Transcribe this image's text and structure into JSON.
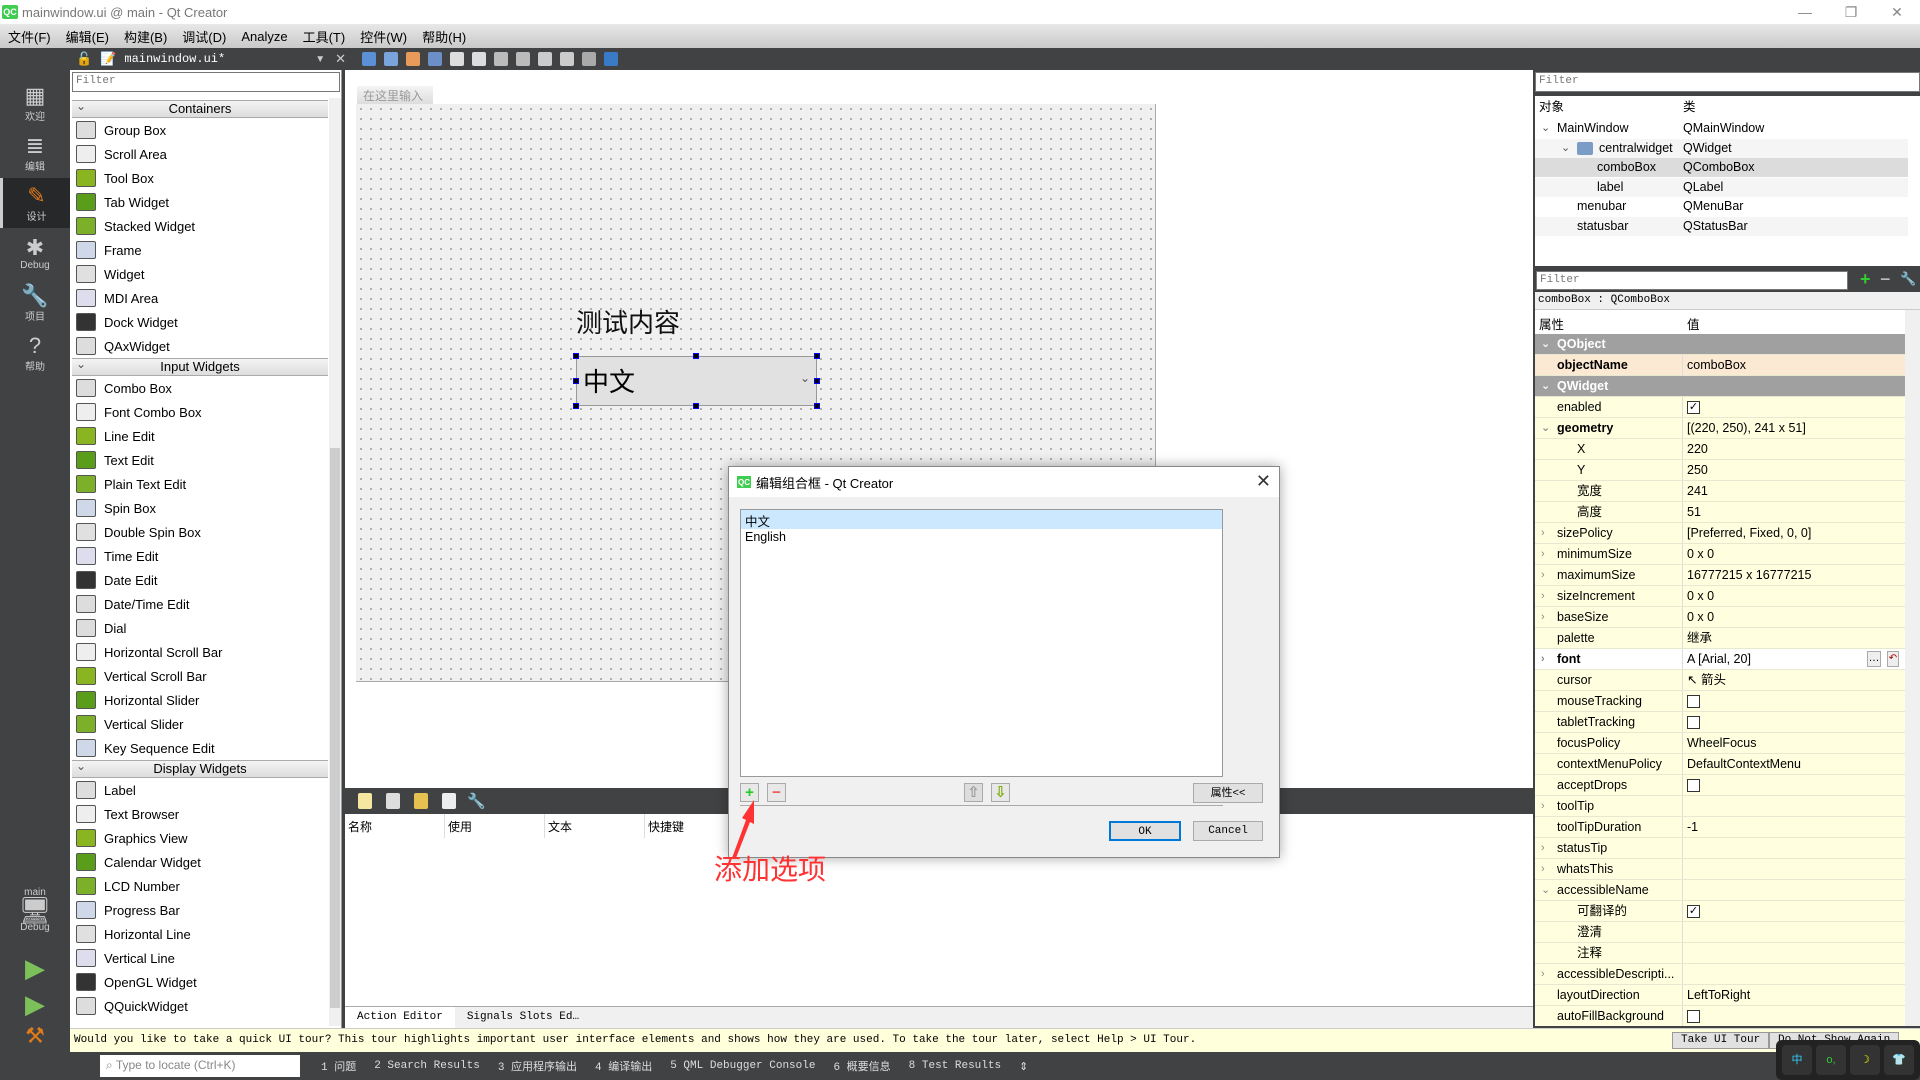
{
  "window": {
    "title": "mainwindow.ui @ main - Qt Creator",
    "logo": "QC",
    "minimize": "—",
    "maximize": "❐",
    "close": "✕"
  },
  "menu": [
    "文件(F)",
    "编辑(E)",
    "构建(B)",
    "调试(D)",
    "Analyze",
    "工具(T)",
    "控件(W)",
    "帮助(H)"
  ],
  "toolbar": {
    "file": "mainwindow.ui*",
    "close": "✕"
  },
  "modes": [
    {
      "label": "欢迎",
      "icon": "▦"
    },
    {
      "label": "编辑",
      "icon": "≣"
    },
    {
      "label": "设计",
      "icon": "✎"
    },
    {
      "label": "Debug",
      "icon": "✱"
    },
    {
      "label": "项目",
      "icon": "🔧"
    },
    {
      "label": "帮助",
      "icon": "?"
    }
  ],
  "kit": {
    "project": "main",
    "config": "Debug"
  },
  "widget_box": {
    "filter_placeholder": "Filter",
    "categories": [
      {
        "name": "Containers",
        "items": [
          "Group Box",
          "Scroll Area",
          "Tool Box",
          "Tab Widget",
          "Stacked Widget",
          "Frame",
          "Widget",
          "MDI Area",
          "Dock Widget",
          "QAxWidget"
        ]
      },
      {
        "name": "Input Widgets",
        "items": [
          "Combo Box",
          "Font Combo Box",
          "Line Edit",
          "Text Edit",
          "Plain Text Edit",
          "Spin Box",
          "Double Spin Box",
          "Time Edit",
          "Date Edit",
          "Date/Time Edit",
          "Dial",
          "Horizontal Scroll Bar",
          "Vertical Scroll Bar",
          "Horizontal Slider",
          "Vertical Slider",
          "Key Sequence Edit"
        ]
      },
      {
        "name": "Display Widgets",
        "items": [
          "Label",
          "Text Browser",
          "Graphics View",
          "Calendar Widget",
          "LCD Number",
          "Progress Bar",
          "Horizontal Line",
          "Vertical Line",
          "OpenGL Widget",
          "QQuickWidget"
        ]
      }
    ]
  },
  "form": {
    "menu_hint": "在这里输入",
    "label_text": "测试内容",
    "combo_text": "中文"
  },
  "action_editor": {
    "columns": [
      "名称",
      "使用",
      "文本",
      "快捷键"
    ],
    "tabs": [
      "Action Editor",
      "Signals Slots Ed…"
    ]
  },
  "object_inspector": {
    "filter_placeholder": "Filter",
    "headers": [
      "对象",
      "类"
    ],
    "rows": [
      {
        "name": "MainWindow",
        "cls": "QMainWindow",
        "level": 0,
        "expanded": true
      },
      {
        "name": "centralwidget",
        "cls": "QWidget",
        "level": 1,
        "expanded": true
      },
      {
        "name": "comboBox",
        "cls": "QComboBox",
        "level": 2,
        "selected": true
      },
      {
        "name": "label",
        "cls": "QLabel",
        "level": 2
      },
      {
        "name": "menubar",
        "cls": "QMenuBar",
        "level": 1
      },
      {
        "name": "statusbar",
        "cls": "QStatusBar",
        "level": 1
      }
    ]
  },
  "property_editor": {
    "filter_placeholder": "Filter",
    "class_label": "comboBox : QComboBox",
    "headers": [
      "属性",
      "值"
    ],
    "rows": [
      {
        "k": "QObject",
        "type": "group"
      },
      {
        "k": "objectName",
        "v": "comboBox",
        "type": "obj"
      },
      {
        "k": "QWidget",
        "type": "group"
      },
      {
        "k": "enabled",
        "check": true
      },
      {
        "k": "geometry",
        "v": "[(220, 250), 241 x 51]",
        "type": "bold",
        "exp": "open"
      },
      {
        "k": "X",
        "v": "220",
        "type": "sub"
      },
      {
        "k": "Y",
        "v": "250",
        "type": "sub"
      },
      {
        "k": "宽度",
        "v": "241",
        "type": "sub"
      },
      {
        "k": "高度",
        "v": "51",
        "type": "sub"
      },
      {
        "k": "sizePolicy",
        "v": "[Preferred, Fixed, 0, 0]",
        "exp": "closed"
      },
      {
        "k": "minimumSize",
        "v": "0 x 0",
        "exp": "closed"
      },
      {
        "k": "maximumSize",
        "v": "16777215 x 16777215",
        "exp": "closed"
      },
      {
        "k": "sizeIncrement",
        "v": "0 x 0",
        "exp": "closed"
      },
      {
        "k": "baseSize",
        "v": "0 x 0",
        "exp": "closed"
      },
      {
        "k": "palette",
        "v": "继承"
      },
      {
        "k": "font",
        "v": "A [Arial, 20]",
        "type": "boldfont",
        "exp": "closed"
      },
      {
        "k": "cursor",
        "v": "↖ 箭头"
      },
      {
        "k": "mouseTracking",
        "check": false
      },
      {
        "k": "tabletTracking",
        "check": false
      },
      {
        "k": "focusPolicy",
        "v": "WheelFocus"
      },
      {
        "k": "contextMenuPolicy",
        "v": "DefaultContextMenu"
      },
      {
        "k": "acceptDrops",
        "check": false
      },
      {
        "k": "toolTip",
        "v": "",
        "exp": "closed"
      },
      {
        "k": "toolTipDuration",
        "v": "-1"
      },
      {
        "k": "statusTip",
        "v": "",
        "exp": "closed"
      },
      {
        "k": "whatsThis",
        "v": "",
        "exp": "closed"
      },
      {
        "k": "accessibleName",
        "v": "",
        "exp": "open"
      },
      {
        "k": "可翻译的",
        "check": true,
        "type": "sub"
      },
      {
        "k": "澄清",
        "v": "",
        "type": "sub"
      },
      {
        "k": "注释",
        "v": "",
        "type": "sub"
      },
      {
        "k": "accessibleDescripti...",
        "v": "",
        "exp": "closed"
      },
      {
        "k": "layoutDirection",
        "v": "LeftToRight"
      },
      {
        "k": "autoFillBackground",
        "check": false
      }
    ]
  },
  "dialog": {
    "title": "编辑组合框 - Qt Creator",
    "items": [
      "中文",
      "English"
    ],
    "selected_index": 0,
    "add": "+",
    "remove": "−",
    "up": "⇧",
    "down": "⇩",
    "properties_button": "属性<<",
    "ok": "OK",
    "cancel": "Cancel"
  },
  "annotation": "添加选项",
  "tour": {
    "message": "Would you like to take a quick UI tour? This tour highlights important user interface elements and shows how they are used. To take the tour later, select Help > UI Tour.",
    "take": "Take UI Tour",
    "dont": "Do Not Show Again"
  },
  "statusbar": {
    "locate_placeholder": "Type to locate (Ctrl+K)",
    "panes": [
      "1 问题",
      "2 Search Results",
      "3 应用程序输出",
      "4 编译输出",
      "5 QML Debugger Console",
      "6 概要信息",
      "8 Test Results"
    ]
  },
  "ime": [
    "中",
    "o,",
    "☽",
    "👕"
  ],
  "colors": {
    "accent_green": "#41cd52",
    "selection": "#cce8ff",
    "property_bg": "#ffffdf",
    "annotation": "#ff3333"
  }
}
